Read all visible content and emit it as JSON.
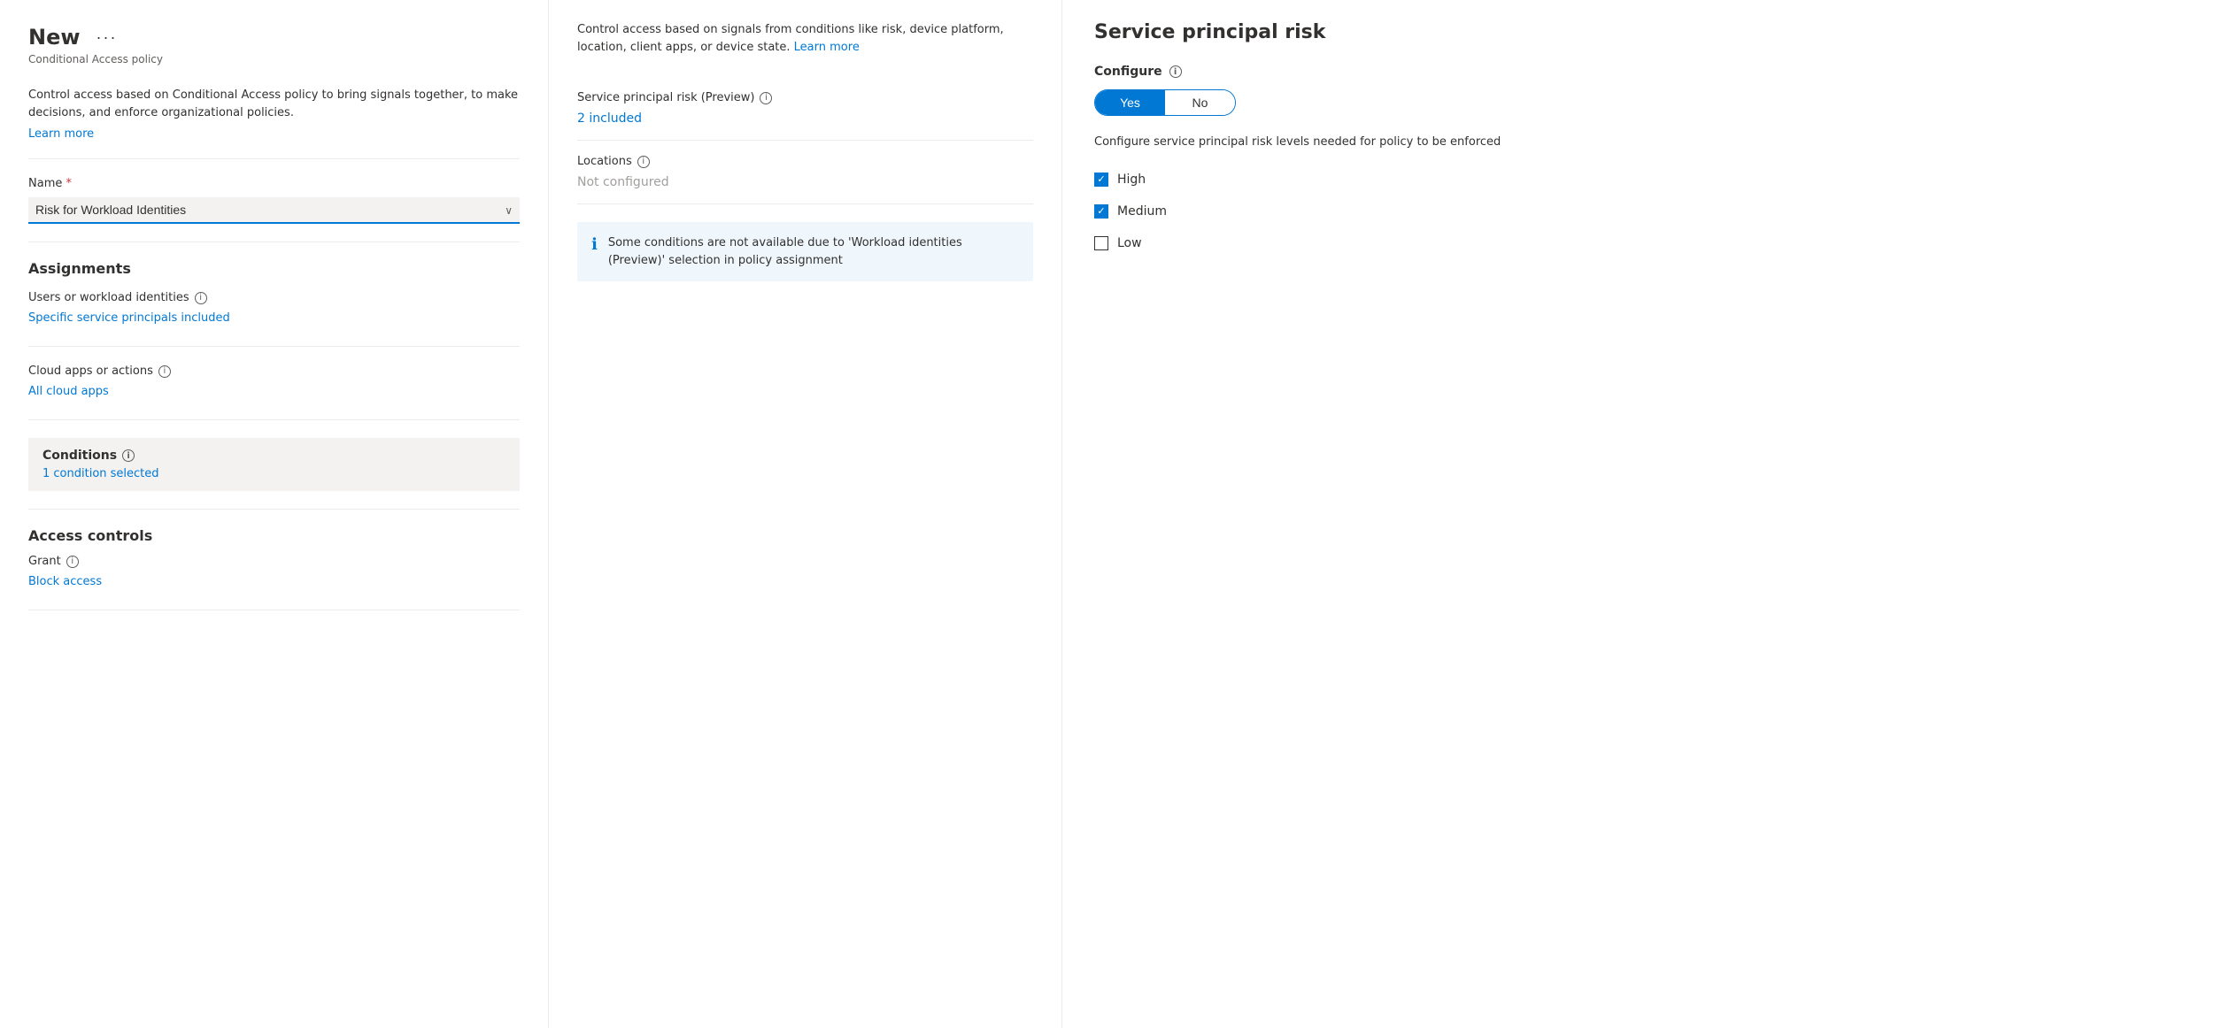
{
  "header": {
    "title": "New",
    "ellipsis": "···",
    "subtitle": "Conditional Access policy"
  },
  "left_panel": {
    "description": "Control access based on Conditional Access policy to bring signals together, to make decisions, and enforce organizational policies.",
    "learn_more": "Learn more",
    "name_label": "Name",
    "name_value": "Risk for Workload Identities",
    "assignments_heading": "Assignments",
    "users_label": "Users or workload identities",
    "users_info": "ⓘ",
    "users_value": "Specific service principals included",
    "cloud_apps_label": "Cloud apps or actions",
    "cloud_apps_info": "ⓘ",
    "cloud_apps_value": "All cloud apps",
    "conditions_heading": "Conditions",
    "conditions_info": "ⓘ",
    "conditions_count": "1 condition selected",
    "access_controls_heading": "Access controls",
    "grant_label": "Grant",
    "grant_info": "ⓘ",
    "grant_value": "Block access"
  },
  "middle_panel": {
    "description": "Control access based on signals from conditions like risk, device platform, location, client apps, or device state.",
    "learn_more": "Learn more",
    "service_principal_risk_label": "Service principal risk (Preview)",
    "service_principal_risk_info": "ⓘ",
    "service_principal_risk_value": "2 included",
    "locations_label": "Locations",
    "locations_info": "ⓘ",
    "locations_value": "Not configured",
    "info_box_text": "Some conditions are not available due to 'Workload identities (Preview)' selection in policy assignment"
  },
  "right_panel": {
    "title": "Service principal risk",
    "configure_label": "Configure",
    "configure_info": "ⓘ",
    "toggle_yes": "Yes",
    "toggle_no": "No",
    "configure_desc": "Configure service principal risk levels needed for policy to be enforced",
    "checkboxes": [
      {
        "id": "high",
        "label": "High",
        "checked": true
      },
      {
        "id": "medium",
        "label": "Medium",
        "checked": true
      },
      {
        "id": "low",
        "label": "Low",
        "checked": false
      }
    ]
  }
}
